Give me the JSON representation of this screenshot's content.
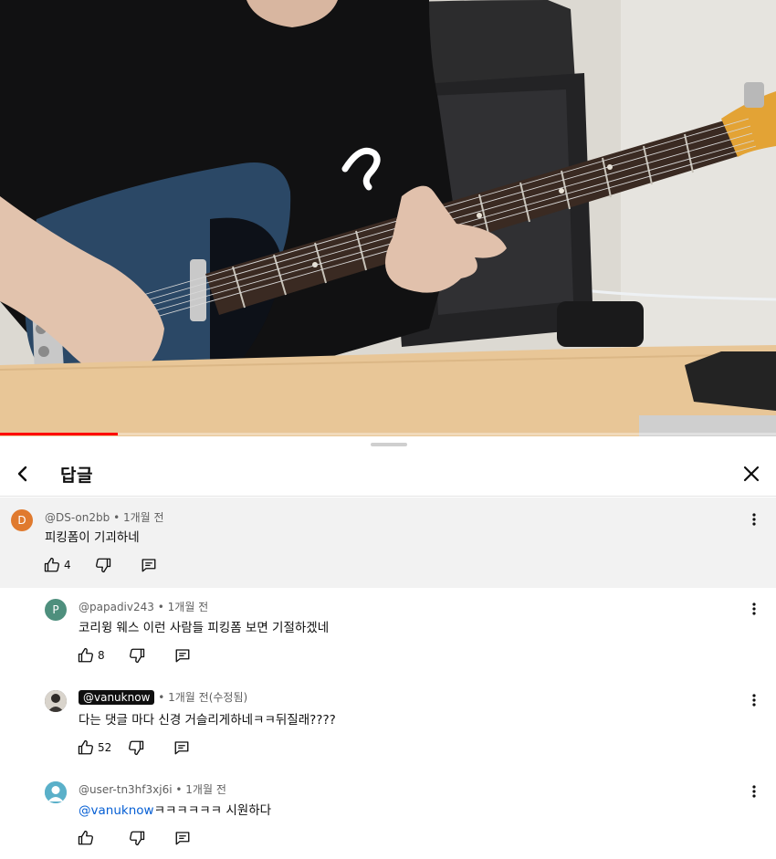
{
  "video": {
    "progress_fraction": 0.152,
    "accent": "#ff0000"
  },
  "sheet": {
    "title": "답글",
    "back_icon": "chevron-left-icon",
    "close_icon": "close-icon"
  },
  "comments": [
    {
      "avatar_letter": "D",
      "avatar_color": "#e07a2e",
      "author": "@DS-on2bb",
      "sep": "•",
      "time": "1개월 전",
      "text": "피킹폼이 기괴하네",
      "likes": "4"
    },
    {
      "avatar_letter": "P",
      "avatar_color": "#4e8f7d",
      "author": "@papadiv243",
      "sep": "•",
      "time": "1개월 전",
      "text": "코리윙 웨스 이런 사람들 피킹폼 보면 기절하겠네",
      "likes": "8"
    },
    {
      "avatar_letter": "",
      "avatar_color": "#4a4a4a",
      "author": "@vanuknow",
      "sep": "•",
      "time": "1개월 전(수정됨)",
      "text": "다는 댓글 마다 신경 거슬리게하네ㅋㅋ뒤질래????",
      "likes": "52"
    },
    {
      "avatar_letter": "",
      "avatar_color": "#5ab0c9",
      "author": "@user-tn3hf3xj6i",
      "sep": "•",
      "time": "1개월 전",
      "mention": "@vanuknow",
      "text": "ㅋㅋㅋㅋㅋㅋ 시원하다",
      "likes": ""
    }
  ]
}
